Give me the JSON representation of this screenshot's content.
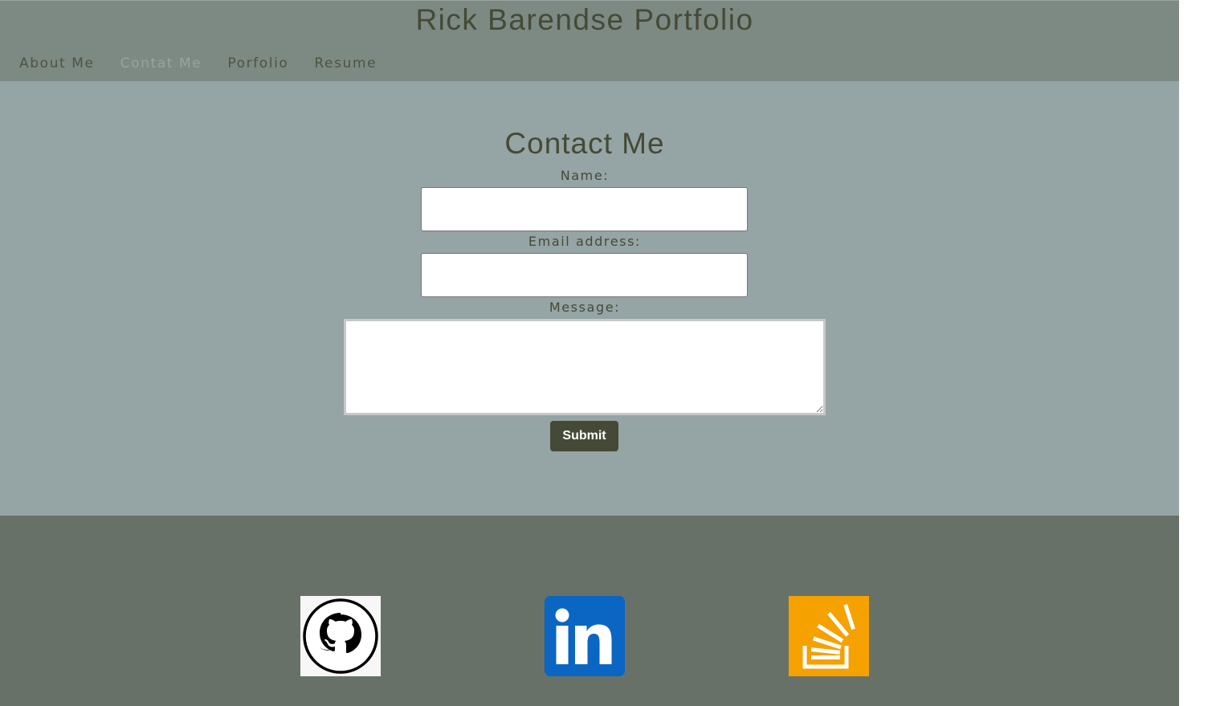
{
  "header": {
    "title": "Rick Barendse Portfolio",
    "nav": [
      {
        "label": "About Me",
        "active": false
      },
      {
        "label": "Contat Me",
        "active": true
      },
      {
        "label": "Porfolio",
        "active": false
      },
      {
        "label": "Resume",
        "active": false
      }
    ]
  },
  "contact_form": {
    "title": "Contact Me",
    "name_label": "Name:",
    "name_value": "",
    "email_label": "Email address:",
    "email_value": "",
    "message_label": "Message:",
    "message_value": "",
    "submit_label": "Submit"
  },
  "footer": {
    "links": [
      {
        "icon": "github-icon"
      },
      {
        "icon": "linkedin-icon"
      },
      {
        "icon": "stackoverflow-icon"
      }
    ]
  },
  "colors": {
    "header_bg": "#7d8983",
    "main_bg": "#95a4a4",
    "footer_bg": "#687168",
    "text_dark": "#454a36",
    "nav_active": "#98a39e",
    "button_bg": "#454a36",
    "linkedin_blue": "#0a66c2",
    "stackoverflow_orange": "#f5a100"
  }
}
